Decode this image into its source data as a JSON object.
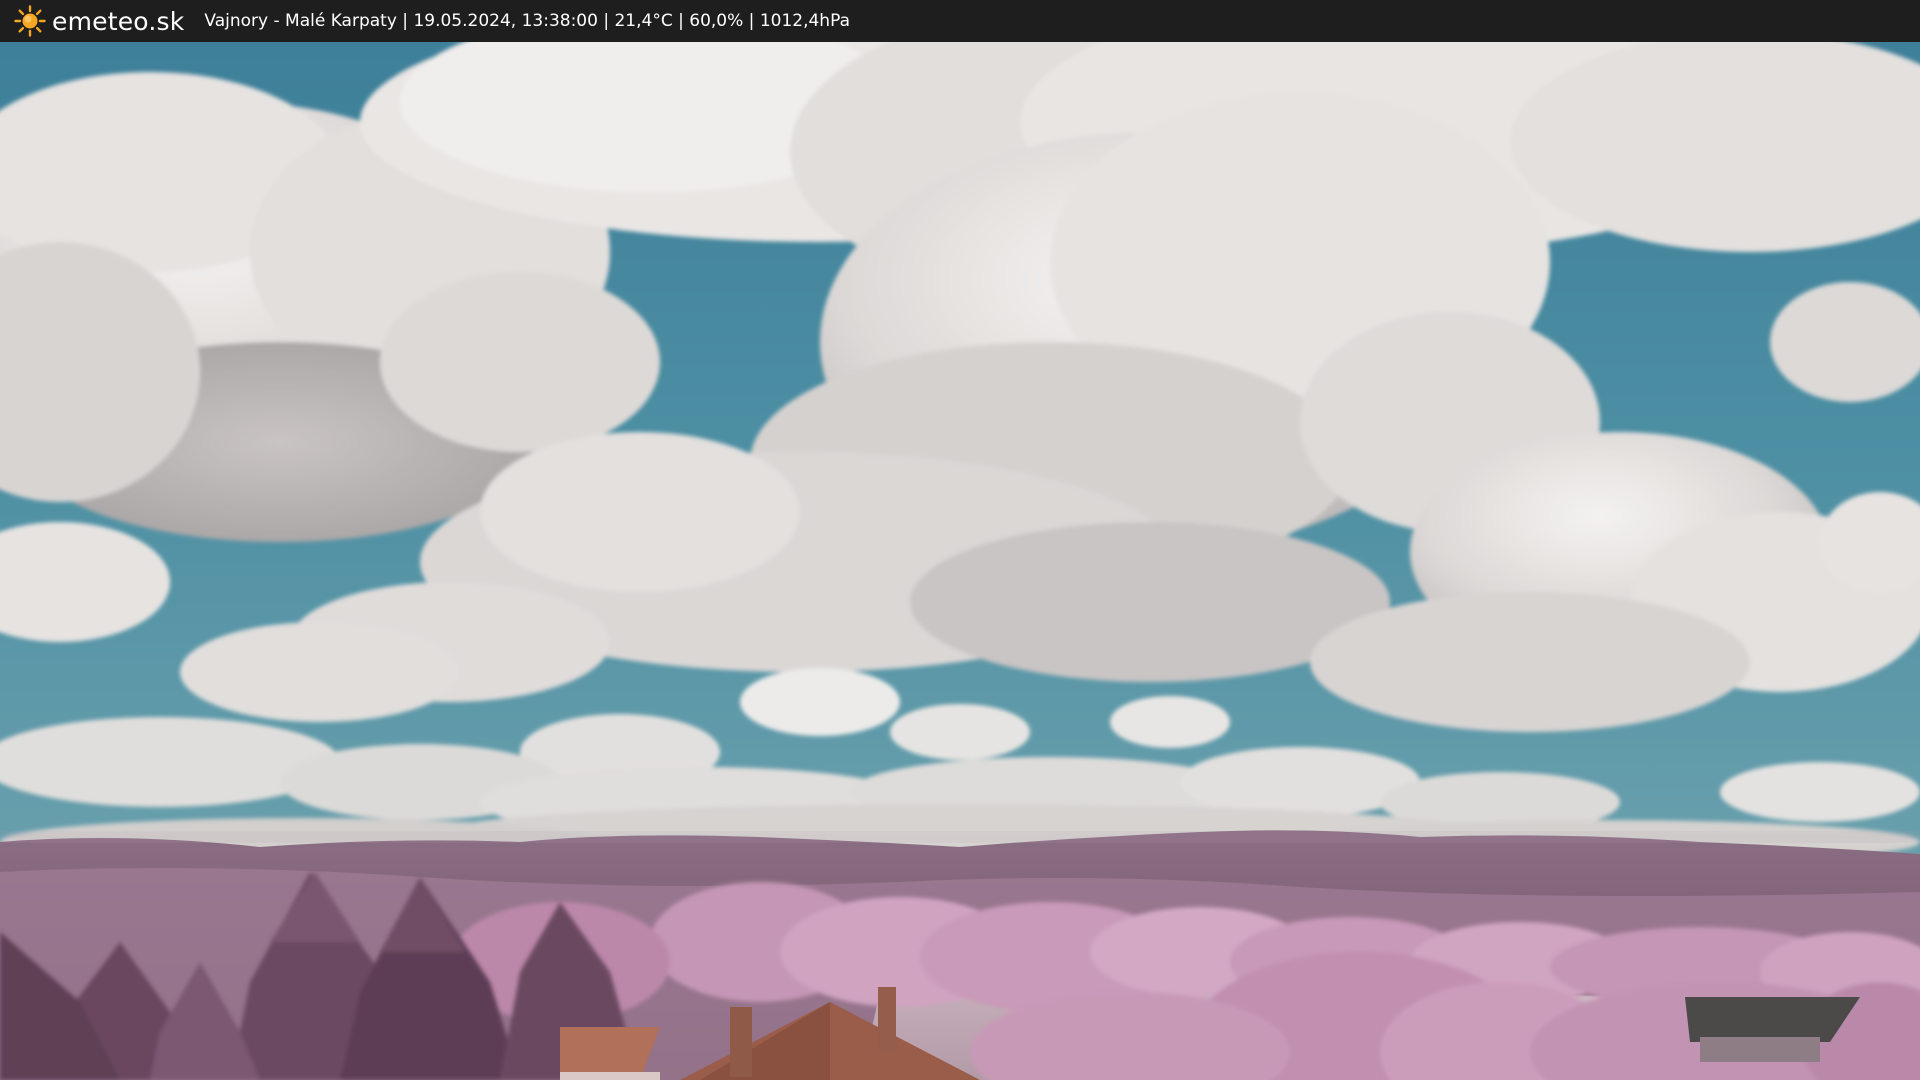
{
  "header": {
    "brand": "emeteo.sk",
    "location": "Vajnory - Malé Karpaty",
    "datetime": "19.05.2024, 13:38:00",
    "temperature": "21,4°C",
    "humidity": "60,0%",
    "pressure": "1012,4hPa",
    "separator": " | "
  },
  "colors": {
    "bar_background": "#1e1e1e",
    "bar_text": "#ffffff",
    "sun_icon": "#f5a623",
    "sky": "#4d8fa3",
    "cloud": "#ebe8e6",
    "hills": "#8a6a80",
    "foliage": "#c99ab9",
    "roof": "#a1624e"
  },
  "icons": {
    "logo": "sun-icon"
  },
  "scene": {
    "type": "infrared webcam photo",
    "content": [
      "blue sky",
      "cumulus clouds",
      "purple hills",
      "pink foliage",
      "red-tiled rooftops",
      "chimneys",
      "conifer trees",
      "field"
    ]
  }
}
